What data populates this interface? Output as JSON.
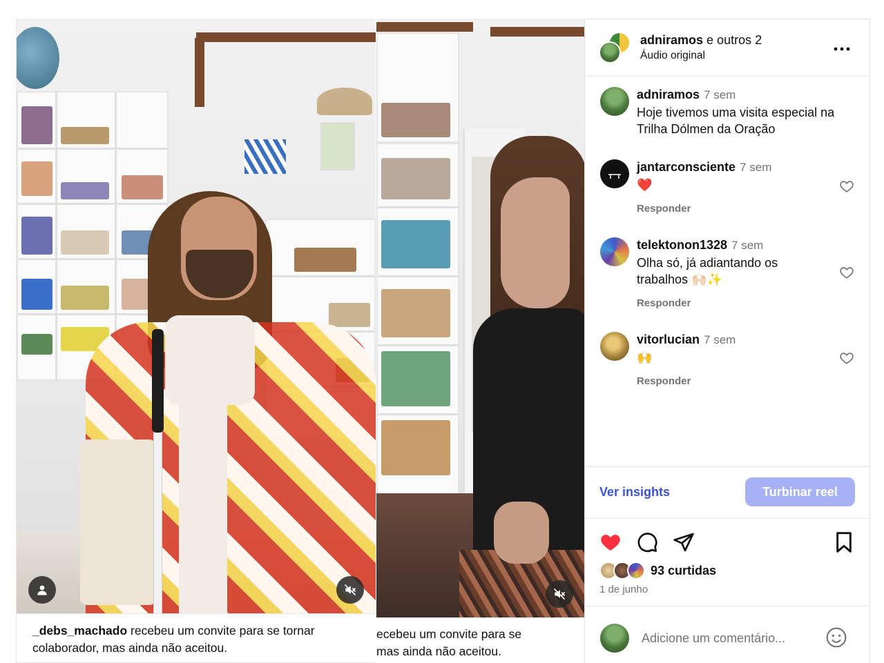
{
  "post": {
    "header": {
      "username": "adniramos",
      "others": "e outros 2",
      "audio": "Áudio original",
      "more_icon": "more-horizontal-icon"
    },
    "comments": [
      {
        "user": "adniramos",
        "time": "7 sem",
        "text": "Hoje tivemos uma visita especial na Trilha Dólmen da Oração",
        "reply": ""
      },
      {
        "user": "jantarconsciente",
        "time": "7 sem",
        "text": "❤️",
        "reply": "Responder"
      },
      {
        "user": "telektonon1328",
        "time": "7 sem",
        "text": "Olha só, já adiantando os trabalhos 🙌🏻✨",
        "reply": "Responder"
      },
      {
        "user": "vitorlucian",
        "time": "7 sem",
        "text": "🙌",
        "reply": "Responder"
      }
    ],
    "insights_label": "Ver insights",
    "boost_label": "Turbinar reel",
    "likes_count": "93 curtidas",
    "date": "1 de junho",
    "comment_placeholder": "Adicione um comentário...",
    "liked": true,
    "colors": {
      "accent": "#3b52d6",
      "boost": "#a7b1f5",
      "like": "#ff3040"
    }
  },
  "media": {
    "left_caption_user": "_debs_machado",
    "left_caption_text": " recebeu um convite para se tornar colaborador, mas ainda não aceitou.",
    "mid_caption_line1": "ecebeu um convite para se",
    "mid_caption_line2": "mas ainda não aceitou."
  }
}
